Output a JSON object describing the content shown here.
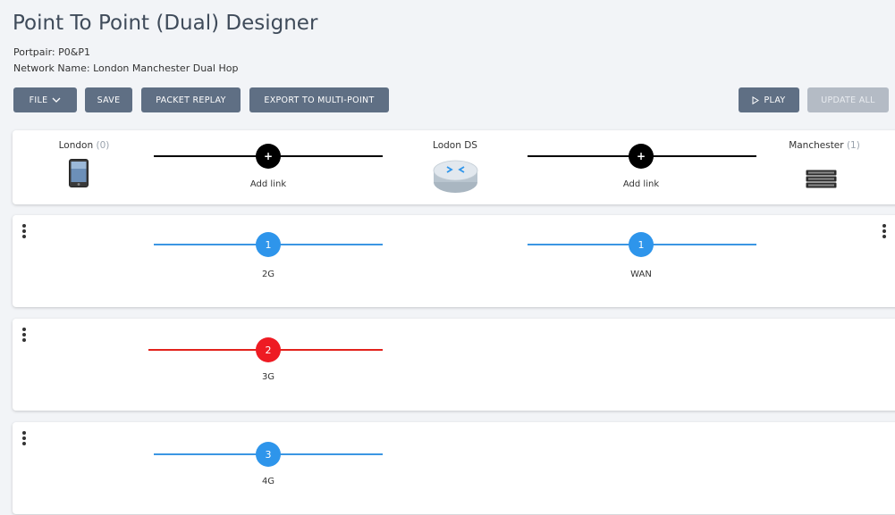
{
  "header": {
    "title": "Point To Point (Dual) Designer",
    "portpair": "Portpair: P0&P1",
    "network_name": "Network Name: London Manchester Dual Hop"
  },
  "toolbar": {
    "file_label": "FILE",
    "save_label": "SAVE",
    "packet_replay_label": "PACKET REPLAY",
    "export_label": "EXPORT TO MULTI-POINT",
    "play_label": "PLAY",
    "update_all_label": "UPDATE ALL"
  },
  "topology": {
    "nodes": [
      {
        "name": "London",
        "count": "(0)",
        "icon": "mobile-phone-icon"
      },
      {
        "name": "Lodon DS",
        "count": "",
        "icon": "router-icon"
      },
      {
        "name": "Manchester",
        "count": "(1)",
        "icon": "server-rack-icon"
      }
    ],
    "add_link_left": "Add link",
    "add_link_right": "Add link",
    "add_symbol": "+"
  },
  "link_rows": [
    {
      "left": {
        "number": "1",
        "label": "2G",
        "color": "#2e95eb"
      },
      "right": {
        "number": "1",
        "label": "WAN",
        "color": "#2e95eb"
      }
    },
    {
      "left": {
        "number": "2",
        "label": "3G",
        "color": "#ee1b23"
      }
    },
    {
      "left": {
        "number": "3",
        "label": "4G",
        "color": "#2e95eb"
      }
    }
  ],
  "colors": {
    "button_bg": "#5f6f84",
    "button_disabled_bg": "#b4bbc5",
    "link_blue": "#2e95eb",
    "link_red": "#ee1b23"
  }
}
